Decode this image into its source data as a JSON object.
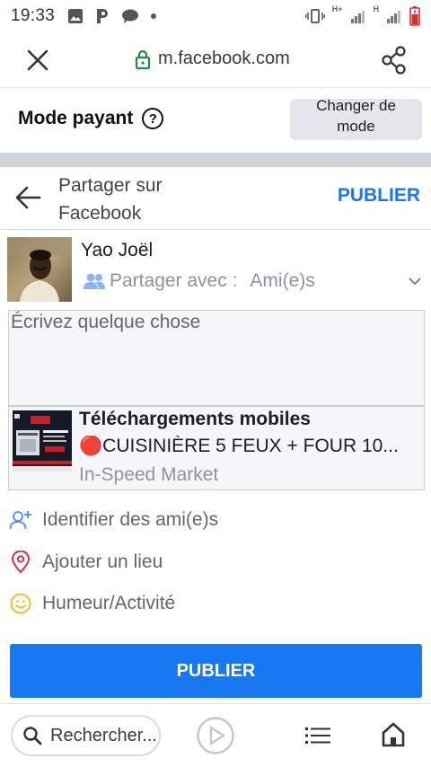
{
  "status_bar": {
    "time": "19:33",
    "net_h_plus": "H+",
    "net_h": "H"
  },
  "browser": {
    "url": "m.facebook.com",
    "icons": [
      "close-icon",
      "lock-icon",
      "share-icon"
    ]
  },
  "mode": {
    "title": "Mode payant",
    "help_glyph": "?",
    "switch_label_line1": "Changer de",
    "switch_label_line2": "mode"
  },
  "share_header": {
    "title_line1": "Partager sur",
    "title_line2": "Facebook",
    "publish_label": "PUBLIER"
  },
  "user": {
    "name": "Yao Joël",
    "audience_label": "Partager avec :",
    "audience_value": "Ami(e)s"
  },
  "composer": {
    "placeholder": "Écrivez quelque chose"
  },
  "link_preview": {
    "title": "Téléchargements mobiles",
    "description": "🔴CUISINIÈRE 5 FEUX + FOUR 10...",
    "source": "In-Speed Market"
  },
  "options": [
    {
      "label": "Identifier des ami(e)s",
      "icon": "tag-friends-icon"
    },
    {
      "label": "Ajouter un lieu",
      "icon": "location-pin-icon"
    },
    {
      "label": "Humeur/Activité",
      "icon": "smiley-icon"
    }
  ],
  "publish_button": {
    "label": "PUBLIER"
  },
  "bottom_bar": {
    "search_placeholder": "Rechercher..."
  },
  "colors": {
    "accent": "#1877f2",
    "pin": "#e41e3f",
    "smiley": "#f7b928",
    "friends": "#1877f2"
  }
}
